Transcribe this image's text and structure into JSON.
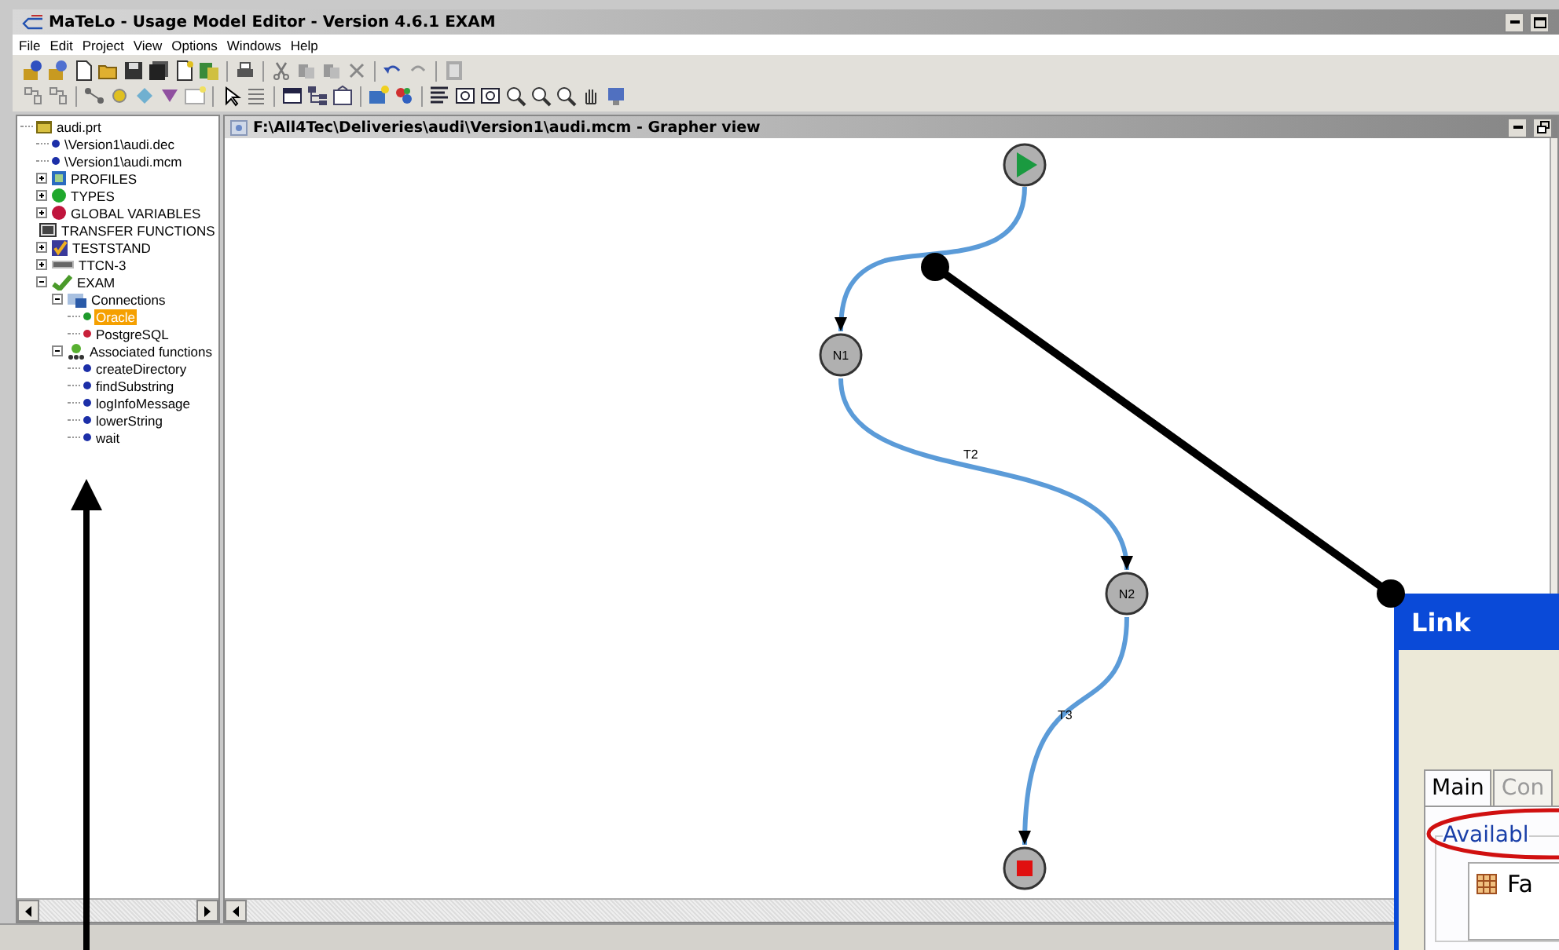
{
  "window": {
    "title": "MaTeLo - Usage Model Editor - Version 4.6.1 EXAM"
  },
  "menu": [
    "File",
    "Edit",
    "Project",
    "View",
    "Options",
    "Windows",
    "Help"
  ],
  "project_tree": {
    "items": [
      {
        "label": "audi.prt",
        "kind": "project",
        "selected": false,
        "children": [
          {
            "label": "\\Version1\\audi.dec",
            "kind": "dot",
            "color": "#1c2fa8",
            "selected": false
          },
          {
            "label": "\\Version1\\audi.mcm",
            "kind": "dot",
            "color": "#1c2fa8",
            "selected": false
          },
          {
            "label": "PROFILES",
            "kind": "profiles",
            "expanded": false,
            "selected": false
          },
          {
            "label": "TYPES",
            "kind": "types",
            "expanded": false,
            "selected": false
          },
          {
            "label": "GLOBAL VARIABLES",
            "kind": "globals",
            "expanded": false,
            "selected": false
          },
          {
            "label": "TRANSFER FUNCTIONS",
            "kind": "transfer",
            "selected": false
          },
          {
            "label": "TESTSTAND",
            "kind": "teststand",
            "expanded": false,
            "selected": false
          },
          {
            "label": "TTCN-3",
            "kind": "ttcn",
            "expanded": false,
            "selected": false
          },
          {
            "label": "EXAM",
            "kind": "exam",
            "expanded": true,
            "selected": false,
            "children": [
              {
                "label": "Connections",
                "kind": "connections",
                "expanded": true,
                "selected": false,
                "children": [
                  {
                    "label": "Oracle",
                    "kind": "dot",
                    "color": "#1f9a2c",
                    "selected": true
                  },
                  {
                    "label": "PostgreSQL",
                    "kind": "dot",
                    "color": "#c8203a",
                    "selected": false
                  }
                ]
              },
              {
                "label": "Associated functions",
                "kind": "functions",
                "expanded": true,
                "selected": false,
                "children": [
                  {
                    "label": "createDirectory",
                    "kind": "dot",
                    "color": "#1c2fa8",
                    "selected": false
                  },
                  {
                    "label": "findSubstring",
                    "kind": "dot",
                    "color": "#1c2fa8",
                    "selected": false
                  },
                  {
                    "label": "logInfoMessage",
                    "kind": "dot",
                    "color": "#1c2fa8",
                    "selected": false
                  },
                  {
                    "label": "lowerString",
                    "kind": "dot",
                    "color": "#1c2fa8",
                    "selected": false
                  },
                  {
                    "label": "wait",
                    "kind": "dot",
                    "color": "#1c2fa8",
                    "selected": false
                  }
                ]
              }
            ]
          }
        ]
      }
    ]
  },
  "grapher": {
    "title": "F:\\All4Tec\\Deliveries\\audi\\Version1\\audi.mcm - Grapher view",
    "nodes": [
      {
        "kind": "start"
      },
      {
        "kind": "state",
        "label": "N1"
      },
      {
        "kind": "state",
        "label": "N2"
      },
      {
        "kind": "end"
      }
    ],
    "transitions": [
      {
        "label": "T2"
      },
      {
        "label": "T3"
      }
    ]
  },
  "link_dialog": {
    "title": "Link",
    "tabs": [
      {
        "label": "Main",
        "selected": true
      },
      {
        "label": "Con",
        "selected": false
      }
    ],
    "group": {
      "title": "Availabl",
      "highlighted": true
    },
    "items": [
      {
        "label": "Fa"
      }
    ]
  }
}
